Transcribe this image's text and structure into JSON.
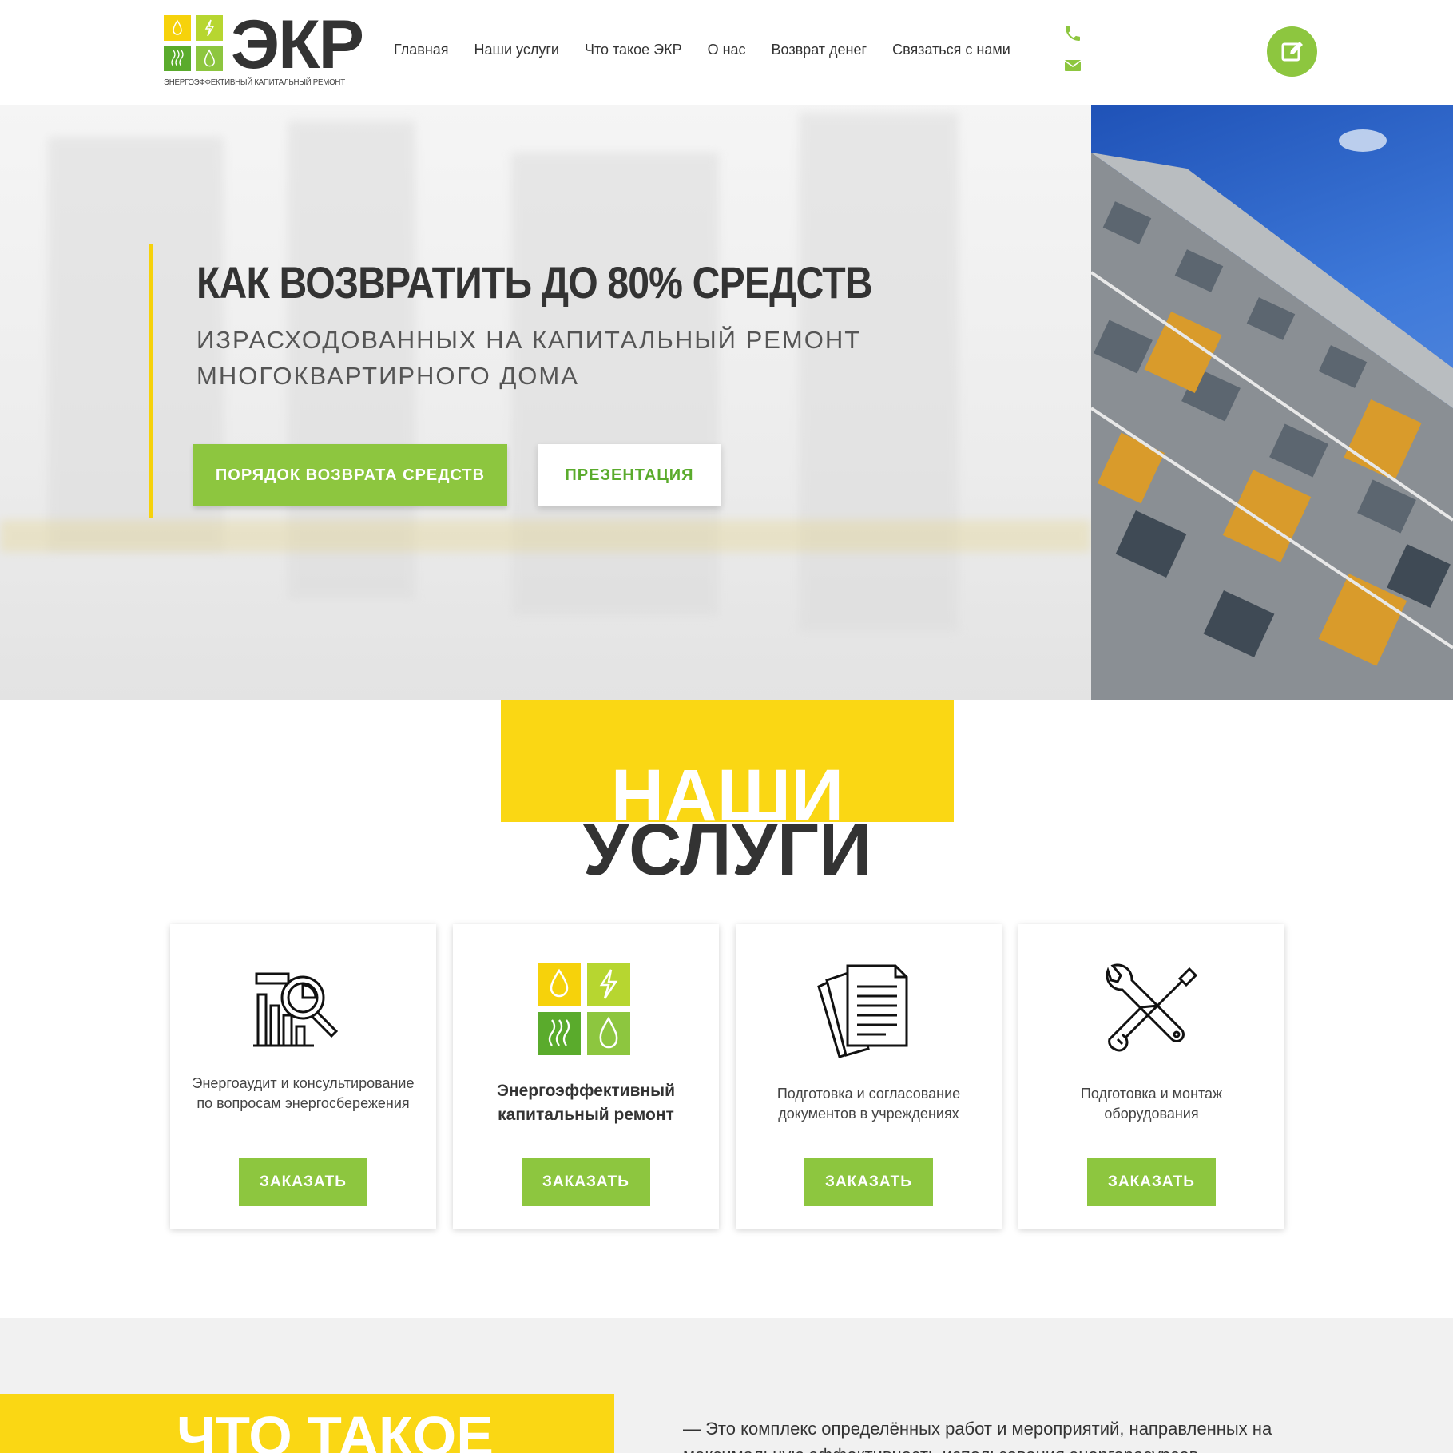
{
  "header": {
    "logo": {
      "text": "ЭКР",
      "subtitle": "Энергоэффективный капитальный ремонт"
    },
    "nav": [
      "Главная",
      "Наши услуги",
      "Что такое ЭКР",
      "О нас",
      "Возврат денег",
      "Связаться с нами"
    ],
    "contact_icons": [
      "phone-icon",
      "envelope-icon"
    ],
    "edit_icon": "edit-icon"
  },
  "hero": {
    "title": "КАК ВОЗВРАТИТЬ ДО 80% СРЕДСТВ",
    "subtitle_line1": "ИЗРАСХОДОВАННЫХ НА КАПИТАЛЬНЫЙ РЕМОНТ",
    "subtitle_line2": "МНОГОКВАРТИРНОГО ДОМА",
    "primary_button": "ПОРЯДОК ВОЗВРАТА СРЕДСТВ",
    "secondary_button": "ПРЕЗЕНТАЦИЯ"
  },
  "services": {
    "title_line1": "НАШИ",
    "title_line2": "УСЛУГИ",
    "cards": [
      {
        "icon": "energy-audit-icon",
        "text": "Энергоаудит и консультирование по вопросам энергосбережения",
        "button": "ЗАКАЗАТЬ"
      },
      {
        "icon": "ekr-logo-icon",
        "text": "Энергоэффективный капитальный ремонт",
        "button": "ЗАКАЗАТЬ"
      },
      {
        "icon": "documents-icon",
        "text": "Подготовка и согласование документов в учреждениях",
        "button": "ЗАКАЗАТЬ"
      },
      {
        "icon": "tools-icon",
        "text": "Подготовка и монтаж оборудования",
        "button": "ЗАКАЗАТЬ"
      }
    ]
  },
  "about": {
    "title": "ЧТО ТАКОЕ",
    "text": "— Это комплекс определённых работ и мероприятий, направленных на максимальную эффективность использования энергоресурсов"
  },
  "colors": {
    "green": "#8dc63f",
    "yellow": "#fad714",
    "dark": "#333333"
  }
}
